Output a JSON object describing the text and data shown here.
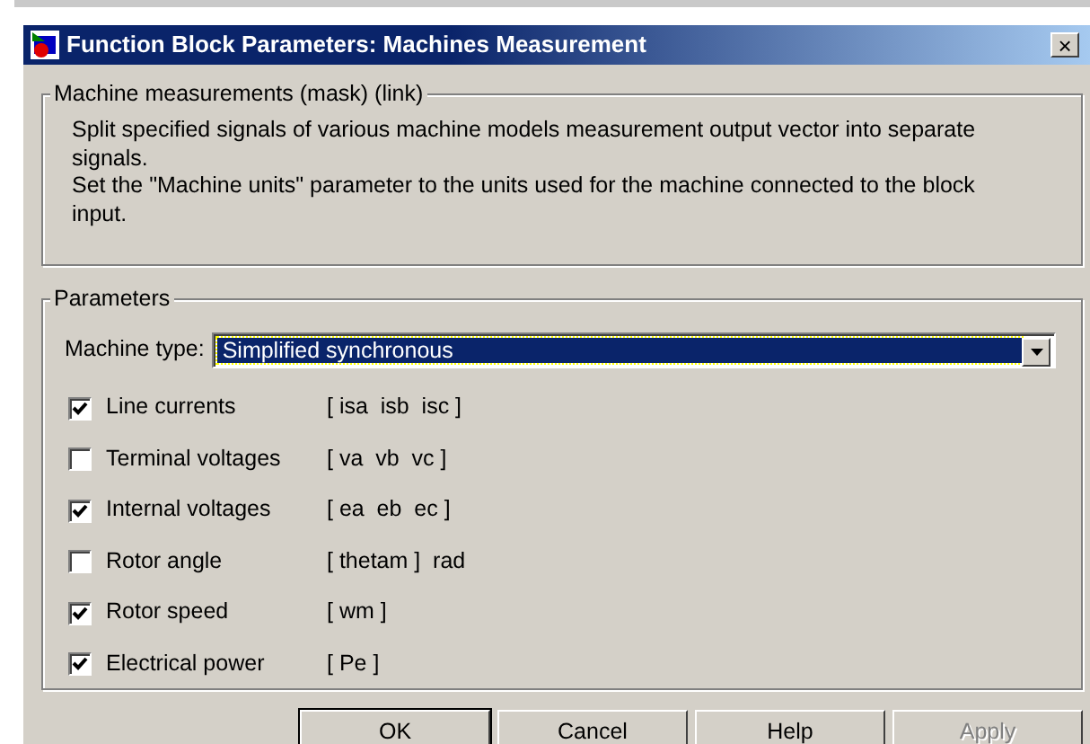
{
  "window": {
    "title": "Function Block Parameters: Machines Measurement",
    "close": "×"
  },
  "description_group": {
    "legend": "Machine measurements (mask) (link)",
    "paragraphs": [
      "Split specified signals of various machine models measurement output vector into separate signals.",
      "Set the \"Machine units\" parameter to the units used for the machine connected to the block input."
    ]
  },
  "parameters_group": {
    "legend": "Parameters",
    "machine_type": {
      "label": "Machine type:",
      "value": "Simplified synchronous"
    },
    "signals": [
      {
        "label": "Line currents",
        "signal": "[ isa  isb  isc ]",
        "checked": true
      },
      {
        "label": "Terminal voltages",
        "signal": "[ va  vb  vc ]",
        "checked": false
      },
      {
        "label": "Internal voltages",
        "signal": "[ ea  eb  ec ]",
        "checked": true
      },
      {
        "label": "Rotor angle",
        "signal": "[ thetam ]  rad",
        "checked": false
      },
      {
        "label": "Rotor speed",
        "signal": "[ wm ]",
        "checked": true
      },
      {
        "label": "Electrical power",
        "signal": "[ Pe ]",
        "checked": true
      }
    ]
  },
  "buttons": [
    {
      "label": "OK",
      "disabled": false,
      "default": true
    },
    {
      "label": "Cancel",
      "disabled": false,
      "default": false
    },
    {
      "label": "Help",
      "disabled": false,
      "default": false
    },
    {
      "label": "Apply",
      "disabled": true,
      "default": false
    }
  ]
}
